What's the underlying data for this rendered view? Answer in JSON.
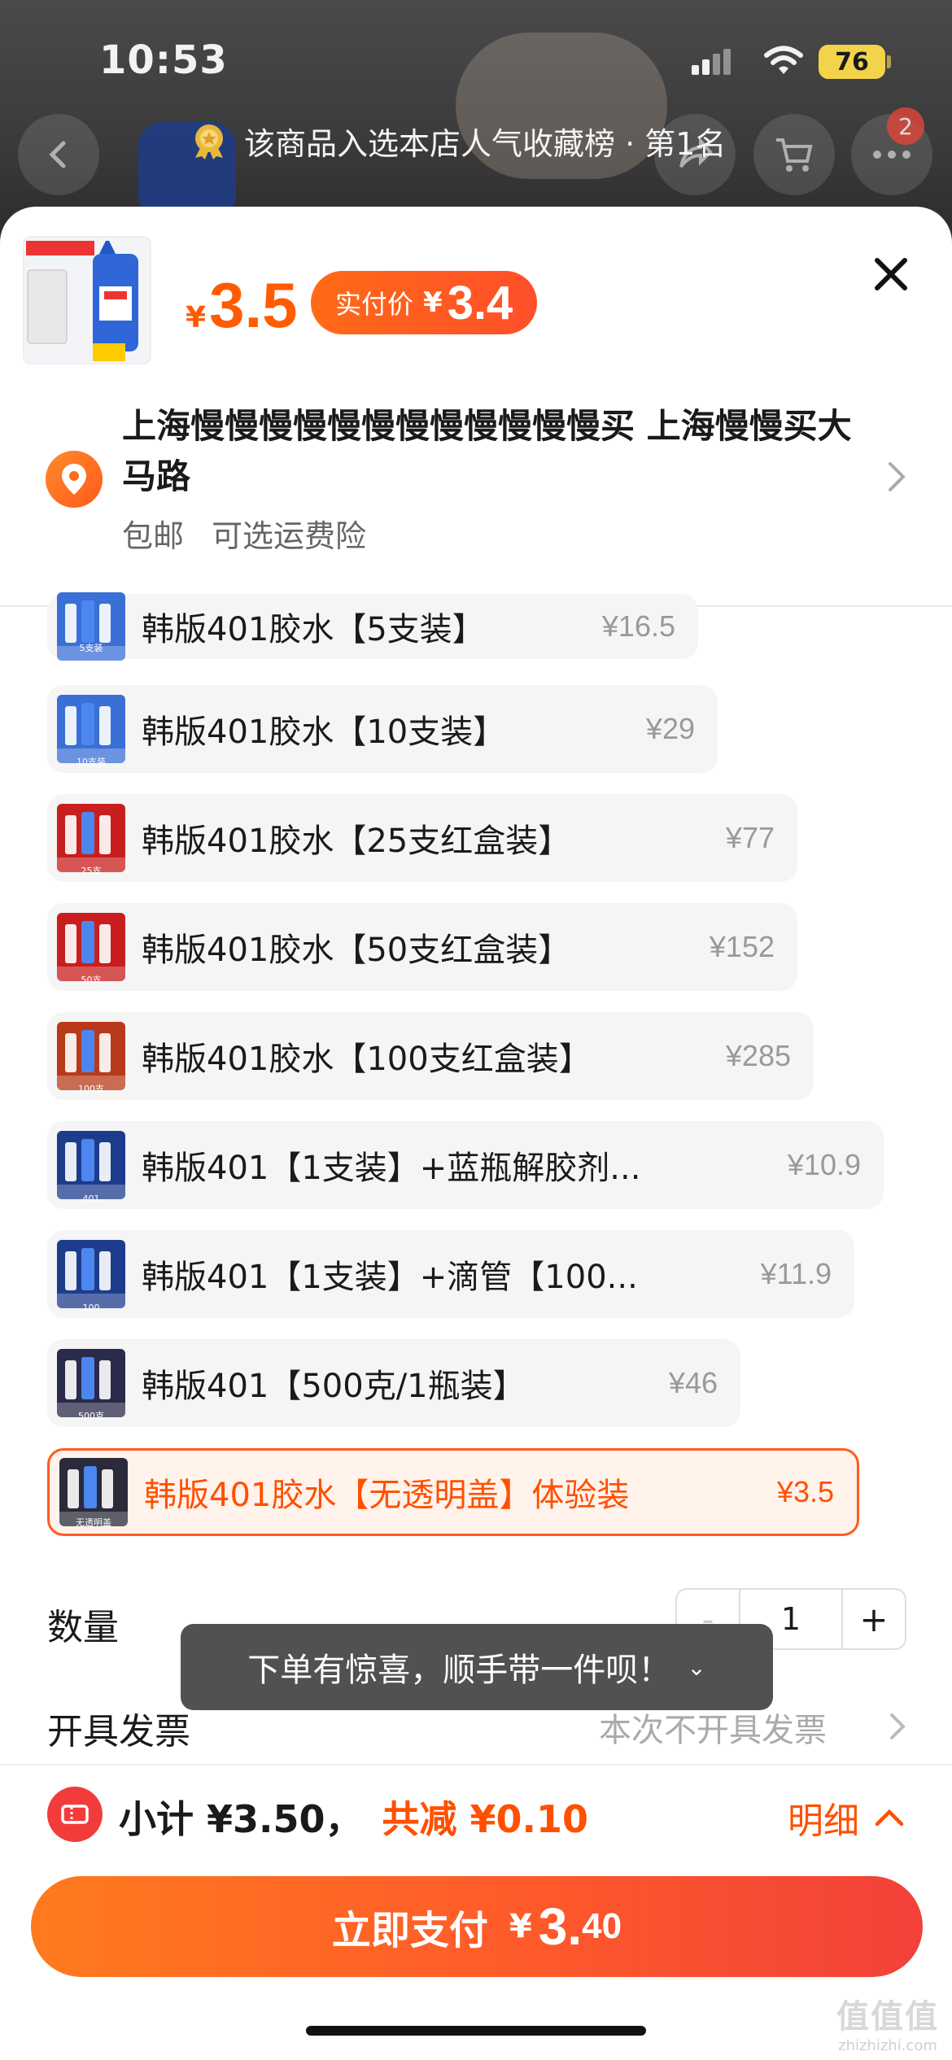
{
  "status_bar": {
    "time": "10:53",
    "battery": "76"
  },
  "banner": {
    "text": "该商品入选本店人气收藏榜 · 第1名"
  },
  "cart_badge": "2",
  "product": {
    "price_symbol": "¥",
    "price": "3.5",
    "pay_label": "实付价",
    "pay_symbol": "¥",
    "pay_price": "3.4"
  },
  "address": {
    "line": "上海慢慢慢慢慢慢慢慢慢慢慢慢买 上海慢慢买大马路",
    "shipping": "包邮",
    "insurance": "可选运费险"
  },
  "options": [
    {
      "label": "韩版401胶水【5支装】",
      "price": "¥16.5",
      "thumb_text": "5支装",
      "selected": false
    },
    {
      "label": "韩版401胶水【10支装】",
      "price": "¥29",
      "thumb_text": "10支装",
      "selected": false
    },
    {
      "label": "韩版401胶水【25支红盒装】",
      "price": "¥77",
      "thumb_text": "25支",
      "selected": false
    },
    {
      "label": "韩版401胶水【50支红盒装】",
      "price": "¥152",
      "thumb_text": "50支",
      "selected": false
    },
    {
      "label": "韩版401胶水【100支红盒装】",
      "price": "¥285",
      "thumb_text": "100支",
      "selected": false
    },
    {
      "label": "韩版401【1支装】+蓝瓶解胶剂...",
      "price": "¥10.9",
      "thumb_text": "401",
      "selected": false
    },
    {
      "label": "韩版401【1支装】+滴管【100...",
      "price": "¥11.9",
      "thumb_text": "100",
      "selected": false
    },
    {
      "label": "韩版401【500克/1瓶装】",
      "price": "¥46",
      "thumb_text": "500克",
      "selected": false
    },
    {
      "label": "韩版401胶水【无透明盖】体验装",
      "price": "¥3.5",
      "thumb_text": "无透明盖",
      "selected": true
    }
  ],
  "quantity": {
    "label": "数量",
    "minus": "-",
    "value": "1",
    "plus": "+"
  },
  "toast": {
    "text": "下单有惊喜，顺手带一件呗！",
    "chevron": "⌄"
  },
  "invoice": {
    "label": "开具发票",
    "value": "本次不开具发票"
  },
  "summary": {
    "subtotal": "小计 ¥3.50，",
    "saving": "共减 ¥0.10",
    "detail": "明细"
  },
  "pay_button": {
    "label": "立即支付",
    "symbol": "¥",
    "int": "3.",
    "dec": "40"
  },
  "watermark": {
    "big": "值值值",
    "small": "zhizhizhi.com"
  },
  "colors": {
    "accent": "#ff5000",
    "pay_gradient_start": "#ff7a1e",
    "pay_gradient_end": "#f2413a",
    "selected_bg": "#fff3ec"
  }
}
